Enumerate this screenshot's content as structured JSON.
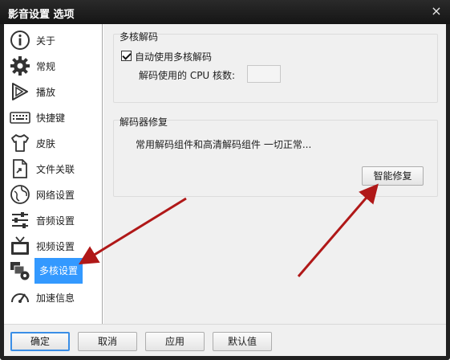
{
  "window": {
    "title": "影音设置 选项",
    "close_label": "×"
  },
  "sidebar": {
    "items": [
      {
        "label": "关于",
        "icon": "info-icon"
      },
      {
        "label": "常规",
        "icon": "gear-icon"
      },
      {
        "label": "播放",
        "icon": "play-icon"
      },
      {
        "label": "快捷键",
        "icon": "keyboard-icon"
      },
      {
        "label": "皮肤",
        "icon": "shirt-icon"
      },
      {
        "label": "文件关联",
        "icon": "file-link-icon"
      },
      {
        "label": "网络设置",
        "icon": "network-icon"
      },
      {
        "label": "音频设置",
        "icon": "audio-icon"
      },
      {
        "label": "视频设置",
        "icon": "tv-icon"
      },
      {
        "label": "多核设置",
        "icon": "multicore-icon",
        "selected": true
      },
      {
        "label": "加速信息",
        "icon": "speedometer-icon"
      }
    ]
  },
  "multicore": {
    "group_title": "多核解码",
    "auto_checkbox_label": "自动使用多核解码",
    "auto_checked": true,
    "cpu_label": "解码使用的 CPU 核数:",
    "cpu_value": ""
  },
  "repair": {
    "group_title": "解码器修复",
    "status_text": "常用解码组件和高清解码组件 一切正常...",
    "button_label": "智能修复"
  },
  "footer": {
    "ok_label": "确定",
    "cancel_label": "取消",
    "apply_label": "应用",
    "default_label": "默认值"
  },
  "colors": {
    "selection": "#3399ff",
    "annotation_arrow": "#b01818"
  }
}
